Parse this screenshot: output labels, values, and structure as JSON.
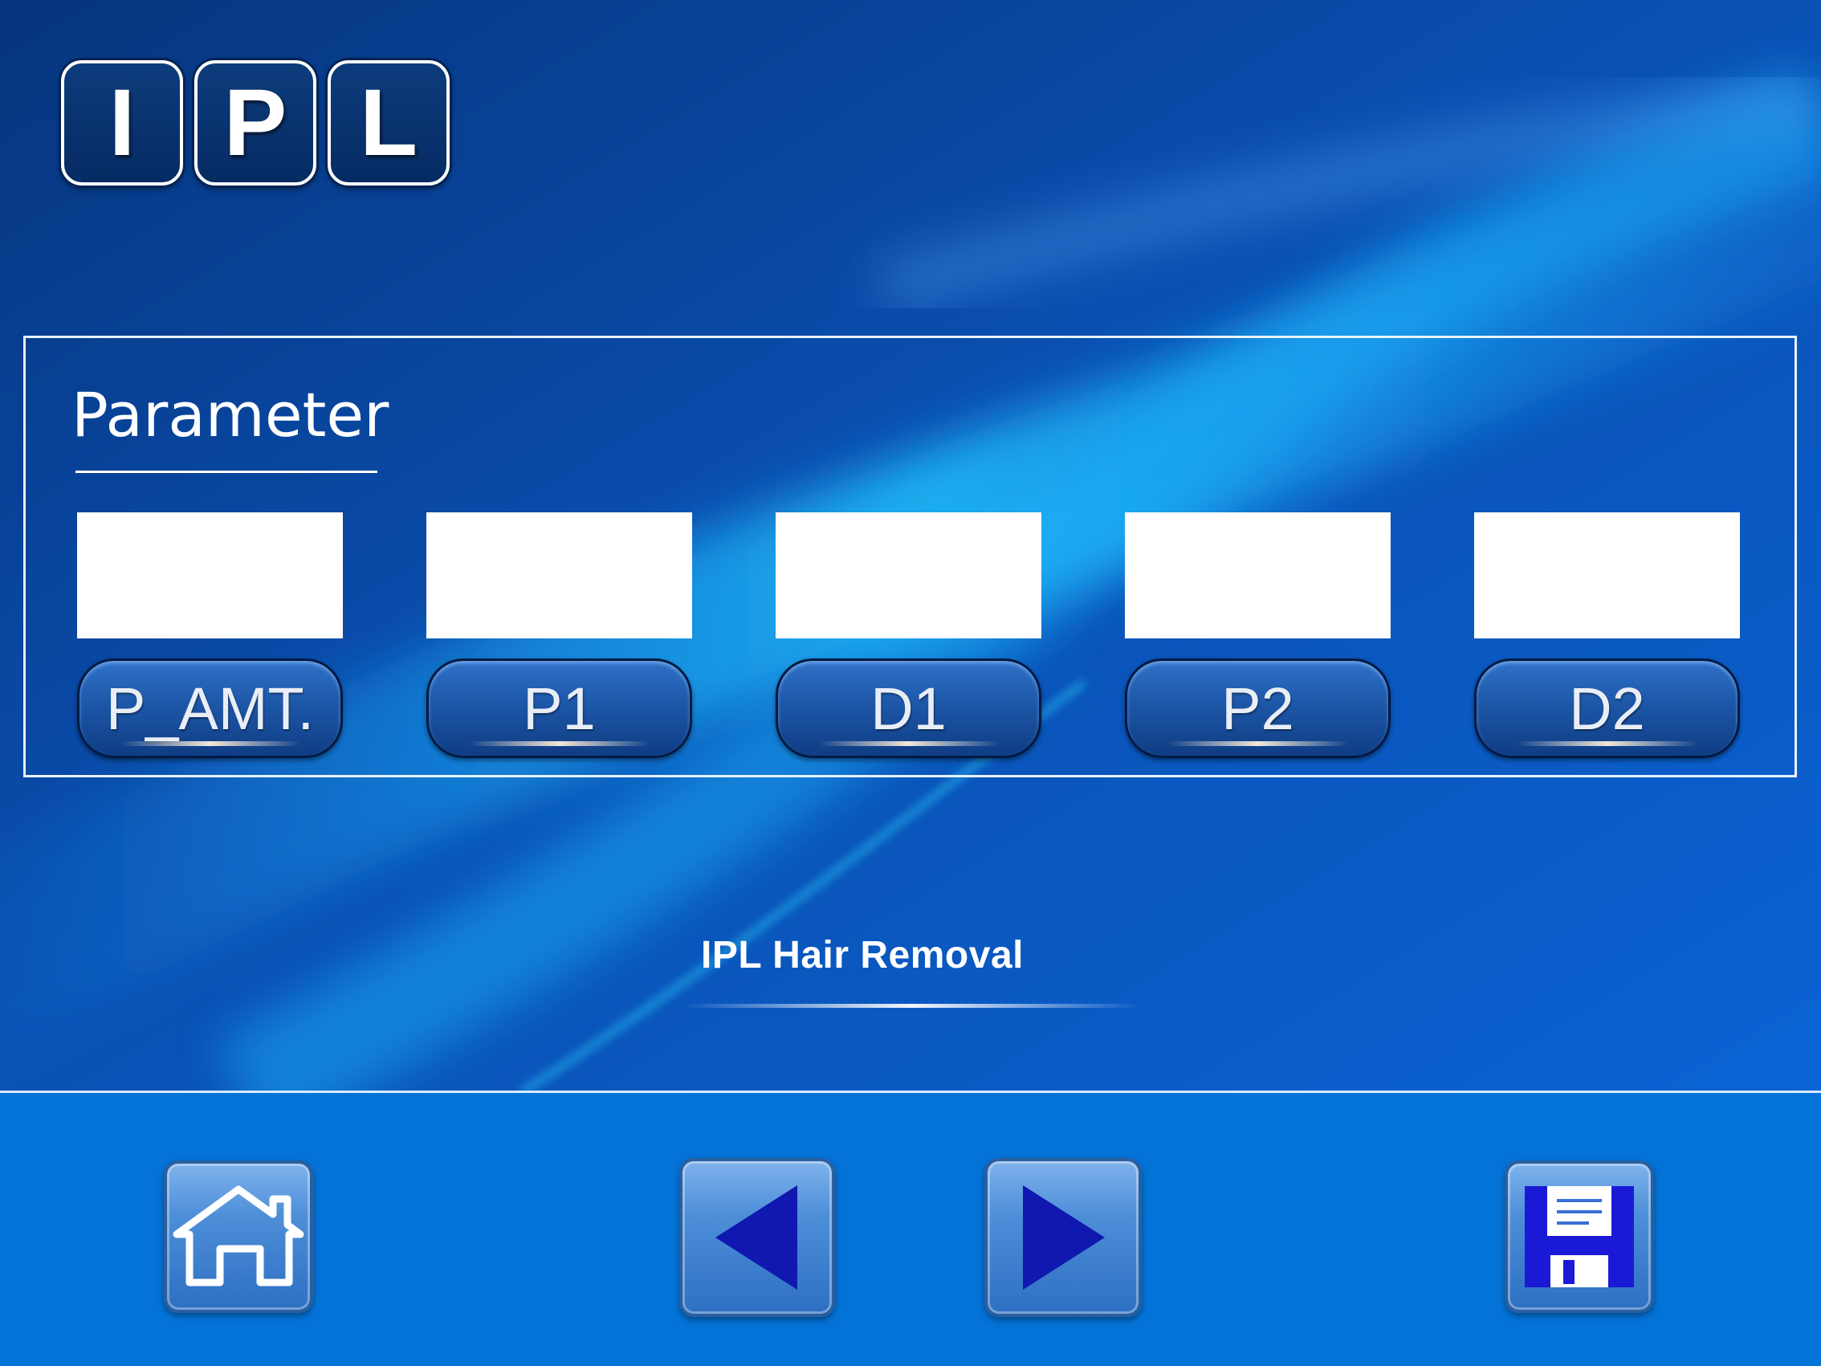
{
  "logo": {
    "letters": [
      "I",
      "P",
      "L"
    ]
  },
  "panel": {
    "title": "Parameter",
    "params": [
      {
        "label": "P_AMT.",
        "value": ""
      },
      {
        "label": "P1",
        "value": ""
      },
      {
        "label": "D1",
        "value": ""
      },
      {
        "label": "P2",
        "value": ""
      },
      {
        "label": "D2",
        "value": ""
      }
    ]
  },
  "app_name": "IPL Hair Removal",
  "nav": {
    "home": {
      "icon": "home-icon"
    },
    "prev": {
      "icon": "arrow-left-icon"
    },
    "next": {
      "icon": "arrow-right-icon"
    },
    "save": {
      "icon": "save-disk-icon"
    }
  },
  "colors": {
    "background": "#0a3f95",
    "bottom_bar": "#0473d8",
    "param_button": "#1d57a8",
    "arrow": "#1018b0",
    "disk": "#1a1ad6"
  }
}
